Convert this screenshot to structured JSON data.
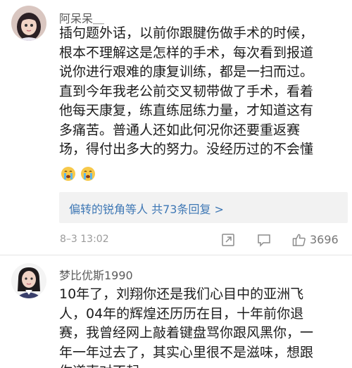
{
  "comments": [
    {
      "username": "阿呆呆＿",
      "body_lines": [
        "插句题外话，以前你跟腱伤做手术的时候，",
        "根本不理解这是怎样的手术，每次看到报道",
        "说你进行艰难的康复训练，都是一扫而过。",
        "直到今年我老公前交叉韧带做了手术，看着",
        "他每天康复，练直练屈练力量，才知道这有",
        "多痛苦。普通人还如此何况你还要重返赛",
        "场，得付出多大的努力。没经历过的不会懂"
      ],
      "emojis": [
        "crying-emoji",
        "crying-emoji"
      ],
      "reply_preview": {
        "user": "偏转的锐角等人",
        "count_text": "共73条回复 >"
      },
      "timestamp": "8–3 13:02",
      "like_count": "3696",
      "icons": [
        "share-icon",
        "comment-icon",
        "like-icon"
      ]
    },
    {
      "username": "梦比优斯1990",
      "body_lines": [
        "10年了，刘翔你还是我们心目中的亚洲飞",
        "人，04年的辉煌还历历在目，十年前你退",
        "赛，我曾经网上敲着键盘骂你跟风黑你，一",
        "年一年过去了，其实心里很不是滋味，想跟",
        "你道声对不起"
      ]
    }
  ],
  "colors": {
    "link": "#3f78b5",
    "muted": "#9a9a9a",
    "reply_bg": "#f2f2f2"
  }
}
